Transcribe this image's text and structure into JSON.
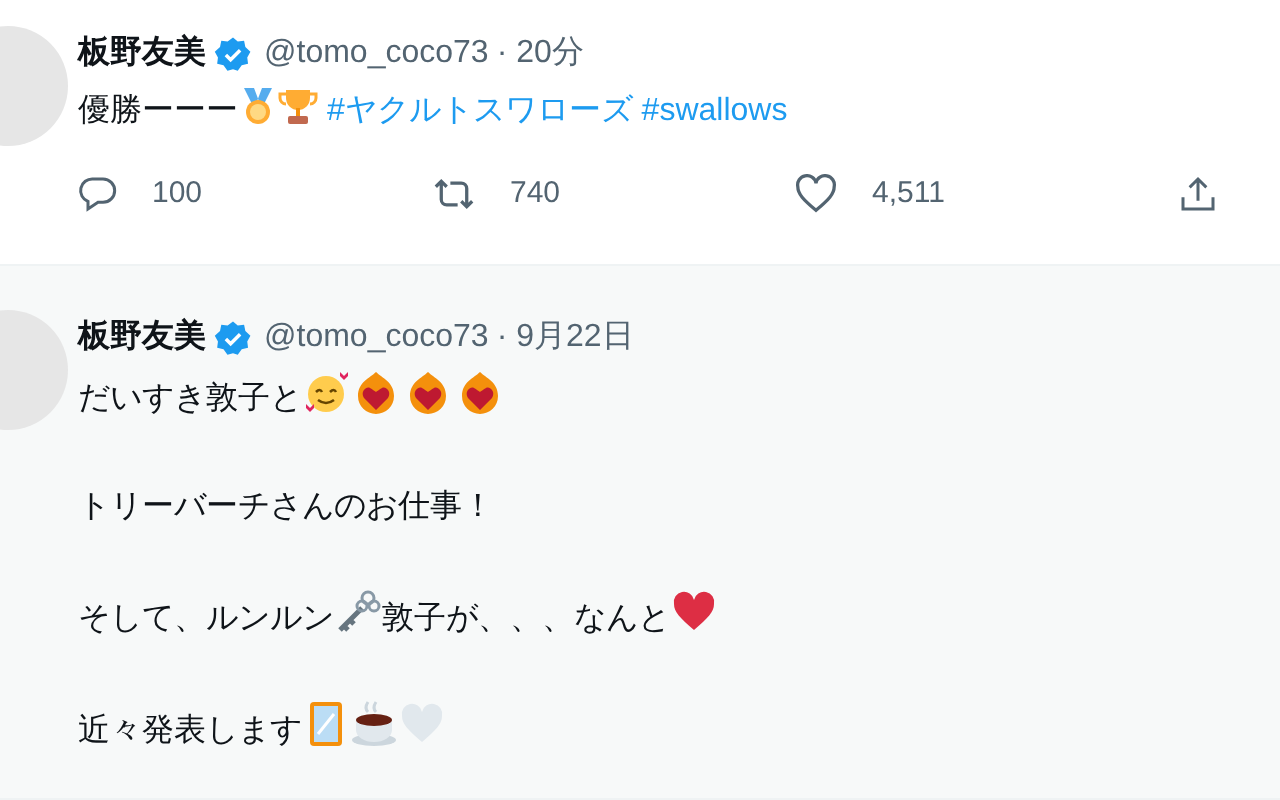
{
  "tweets": [
    {
      "name": "板野友美",
      "verified": true,
      "handle": "@tomo_coco73",
      "time": "· 20分",
      "paragraphs": [
        [
          {
            "kind": "text",
            "text": "優勝ーーー"
          },
          {
            "kind": "medal"
          },
          {
            "kind": "trophy"
          },
          {
            "kind": "hashtag",
            "text": " #ヤクルトスワローズ"
          },
          {
            "kind": "hashtag",
            "text": " #swallows"
          }
        ]
      ],
      "actions": [
        {
          "kind": "reply",
          "count": "100"
        },
        {
          "kind": "retweet",
          "count": "740"
        },
        {
          "kind": "like",
          "count": "4,511"
        },
        {
          "kind": "share"
        }
      ]
    },
    {
      "name": "板野友美",
      "verified": true,
      "handle": "@tomo_coco73",
      "time": "· 9月22日",
      "paragraphs": [
        [
          {
            "kind": "text",
            "text": "だいすき敦子と"
          },
          {
            "kind": "smile"
          },
          {
            "kind": "heart-fire"
          },
          {
            "kind": "heart-fire"
          },
          {
            "kind": "heart-fire"
          }
        ],
        [
          {
            "kind": "text",
            "text": "トリーバーチさんのお仕事！"
          }
        ],
        [
          {
            "kind": "text",
            "text": "そして、ルンルン"
          },
          {
            "kind": "key"
          },
          {
            "kind": "text",
            "text": "敦子が、、、なんと"
          },
          {
            "kind": "heart",
            "color": "#dd2e44"
          }
        ],
        [
          {
            "kind": "text",
            "text": "近々発表します"
          },
          {
            "kind": "mirror"
          },
          {
            "kind": "coffee"
          },
          {
            "kind": "heart",
            "color": "#e1e8ed"
          }
        ]
      ]
    }
  ]
}
